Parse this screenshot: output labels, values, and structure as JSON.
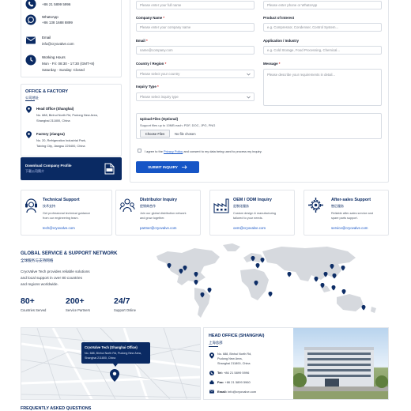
{
  "contact": {
    "phone": "+86 21 5899 5996",
    "whatsapp_label": "WhatsApp",
    "whatsapp": "+86 138 1688 8899",
    "email_label": "Email",
    "email": "info@cryovalve.com",
    "hours_label": "Working Hours",
    "hours_weekday": "Mon - Fri: 08:30 - 17:30 (GMT+8)",
    "hours_weekend": "Saturday - Sunday: Closed"
  },
  "office": {
    "title": "OFFICE & FACTORY",
    "title_cn": "公司地址",
    "head_name": "Head Office (Shanghai)",
    "head_addr1": "No. 688, Binhui North Rd, Pudong New Area,",
    "head_addr2": "Shanghai 211800, China",
    "factory_name": "Factory (Jiangsu)",
    "factory_addr1": "No. 20, Refrigeration Industrial Park,",
    "factory_addr2": "Taixing City, Jiangsu 225400, China"
  },
  "download": {
    "title": "Download Company Profile",
    "subtitle": "下载公司简介"
  },
  "form": {
    "fullname_placeholder": "Please enter your full name",
    "phone_placeholder": "Please enter phone or WhatsApp",
    "company_label": "Company Name",
    "company_placeholder": "Please enter your company name",
    "product_label": "Product of Interest",
    "product_placeholder": "e.g. Compressor, Condenser, Control System...",
    "email_label": "Email",
    "email_placeholder": "name@company.com",
    "application_label": "Application / Industry",
    "application_placeholder": "e.g. Cold Storage, Food Processing, Chemical...",
    "country_label": "Country / Region",
    "country_placeholder": "Please select your country",
    "message_label": "Message",
    "message_placeholder": "Please describe your requirements in detail...",
    "inquiry_label": "Inquiry Type",
    "inquiry_placeholder": "Please select inquiry type",
    "upload_label": "Upload Files (Optional)",
    "upload_hint": "Support files up to 10MB each: PDF, DOC, JPG, PNG",
    "choose_button": "Choose Files",
    "no_file": "No file chosen",
    "agree_pre": "I agree to the",
    "agree_link": "Privacy Policy",
    "agree_post": "and consent to my data being used to process my inquiry.",
    "submit": "SUBMIT INQUIRY",
    "required_mark": "*"
  },
  "support_cards": [
    {
      "title": "Technical Support",
      "cn": "技术支持",
      "desc1": "Get professional technical guidance",
      "desc2": "from our engineering team.",
      "email": "tech@cryovalve.com"
    },
    {
      "title": "Distributor Inquiry",
      "cn": "经销商合作",
      "desc1": "Join our global distribution network",
      "desc2": "and grow together.",
      "email": "partner@cryovalve.com"
    },
    {
      "title": "OEM / ODM Inquiry",
      "cn": "定制化服务",
      "desc1": "Custom design & manufacturing",
      "desc2": "tailored to your needs.",
      "email": "oem@cryovalve.com"
    },
    {
      "title": "After-sales Support",
      "cn": "售后服务",
      "desc1": "Reliable after-sales service and",
      "desc2": "spare parts support.",
      "email": "service@cryovalve.com"
    }
  ],
  "network": {
    "title": "GLOBAL SERVICE & SUPPORT NETWORK",
    "title_cn": "全球服务与支持网络",
    "desc1": "CryoValve Tech provides reliable solutions",
    "desc2": "and local support in over 80 countries",
    "desc3": "and regions worldwide.",
    "stats": [
      {
        "value": "80+",
        "label": "Countries Served"
      },
      {
        "value": "200+",
        "label": "Service Partners"
      },
      {
        "value": "24/7",
        "label": "Support Online"
      }
    ]
  },
  "map_popup": {
    "title": "CryoValve Tech (Shanghai Office)",
    "line1": "No. 688, Binhui North Rd, Pudong New Area,",
    "line2": "Shanghai 211800, China"
  },
  "head_office_panel": {
    "title": "HEAD OFFICE (SHANGHAI)",
    "title_cn": "上海总部",
    "addr1": "No. 688, Binhui North Rd,",
    "addr2": "Pudong New Area,",
    "addr3": "Shanghai 211800, China",
    "tel_label": "Tel:",
    "tel": "+86 21 5899 5996",
    "fax_label": "Fax:",
    "fax": "+86 21 5899 5960",
    "email_label": "Email:",
    "email": "info@cryovalve.com"
  },
  "faq": {
    "title": "FREQUENTLY ASKED QUESTIONS"
  },
  "colors": {
    "navy": "#0a2a63",
    "accent": "#1655c6",
    "pin": "#0d2d66"
  }
}
